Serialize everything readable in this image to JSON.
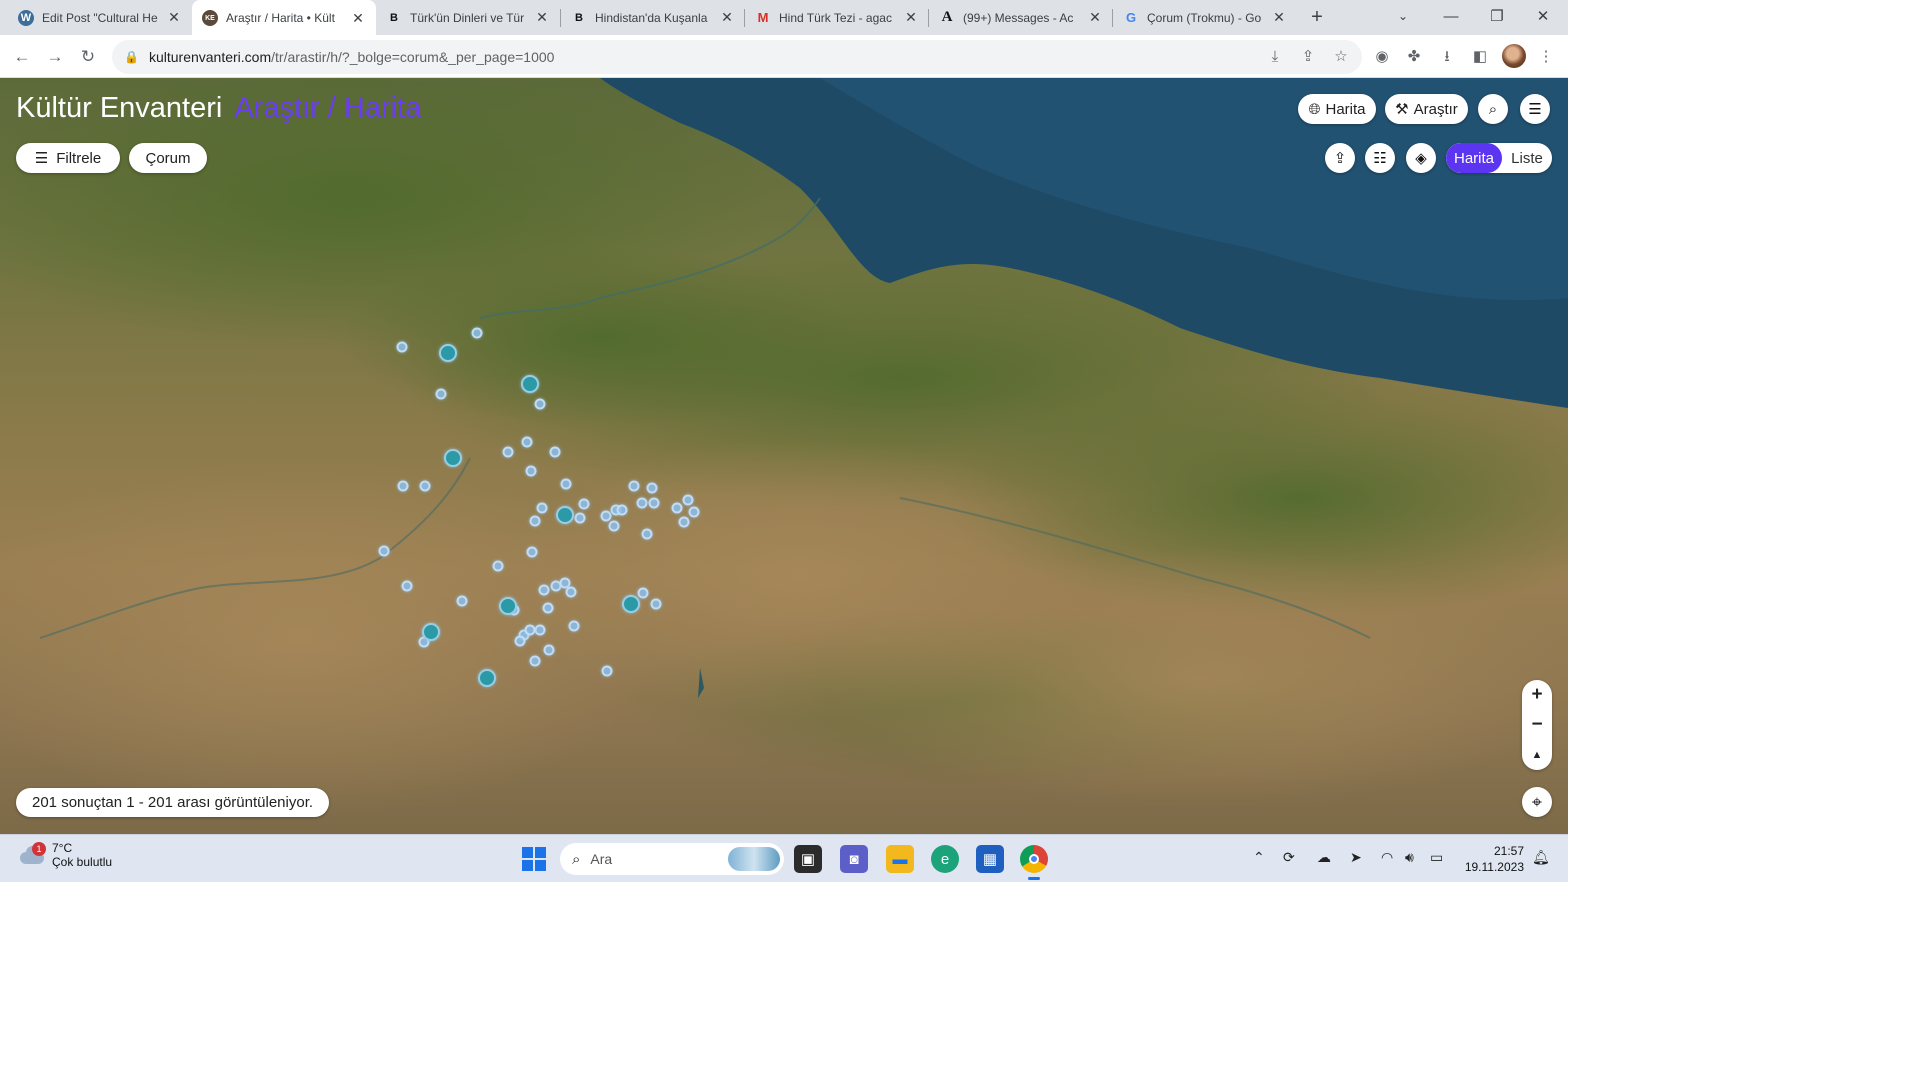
{
  "browser": {
    "tabs": [
      {
        "title": "Edit Post \"Cultural He",
        "icon": "wordpress-icon",
        "active": false
      },
      {
        "title": "Araştır / Harita • Kült",
        "icon": "kulturenvanteri-icon",
        "active": true
      },
      {
        "title": "Türk'ün Dinleri ve Tür",
        "icon": "b-letter-icon",
        "active": false
      },
      {
        "title": "Hindistan'da Kuşanla",
        "icon": "b-letter-icon",
        "active": false
      },
      {
        "title": "Hind Türk Tezi - agac",
        "icon": "gmail-icon",
        "active": false
      },
      {
        "title": "(99+) Messages - Ac",
        "icon": "a-letter-icon",
        "active": false
      },
      {
        "title": "Çorum (Trokmu) - Go",
        "icon": "google-icon",
        "active": false
      }
    ],
    "url_host": "kulturenvanteri.com",
    "url_path": "/tr/arastir/h/?_bolge=corum&_per_page=1000"
  },
  "page": {
    "brand": "Kültür Envanteri",
    "section": "Araştır / Harita",
    "top_buttons": {
      "map": "Harita",
      "research": "Araştır"
    },
    "filter_label": "Filtrele",
    "region_label": "Çorum",
    "view_toggle": {
      "map": "Harita",
      "list": "Liste"
    },
    "results_text": "201 sonuçtan 1 - 201 arası görüntüleniyor.",
    "zoom_in": "+",
    "zoom_out": "−",
    "compass": "▲"
  },
  "colors": {
    "accent": "#5b35f2",
    "marker": "#2c9aa6",
    "sea": "#1f4a66"
  },
  "taskbar": {
    "weather_badge": "1",
    "temperature": "7°C",
    "condition": "Çok bulutlu",
    "search_placeholder": "Ara",
    "time": "21:57",
    "date": "19.11.2023"
  }
}
